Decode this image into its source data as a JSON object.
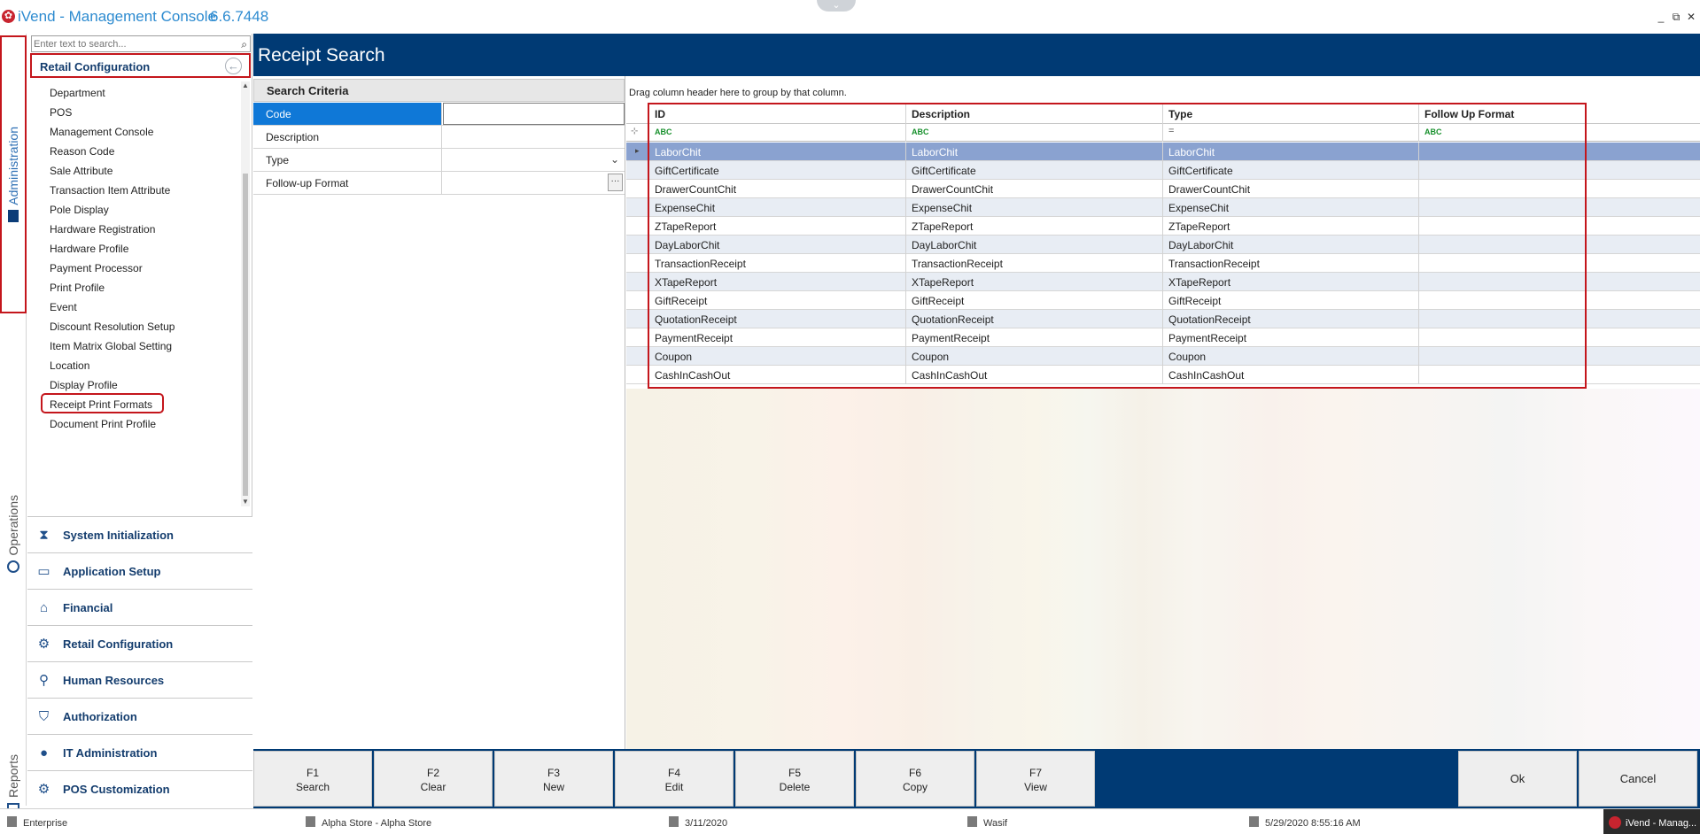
{
  "window": {
    "title": "iVend - Management Console",
    "version": "6.6.7448",
    "controls": {
      "minimize": "_",
      "restore": "⧉",
      "close": "✕"
    },
    "collapse_glyph": "⌄"
  },
  "vertical_tabs": {
    "administration": "Administration",
    "operations": "Operations",
    "reports": "Reports"
  },
  "sidebar": {
    "search_placeholder": "Enter text to search...",
    "section_title": "Retail Configuration",
    "items": [
      {
        "label": "Department"
      },
      {
        "label": "POS"
      },
      {
        "label": "Management Console"
      },
      {
        "label": "Reason Code"
      },
      {
        "label": "Sale Attribute"
      },
      {
        "label": "Transaction Item Attribute"
      },
      {
        "label": "Pole Display"
      },
      {
        "label": "Hardware Registration"
      },
      {
        "label": "Hardware Profile"
      },
      {
        "label": "Payment Processor"
      },
      {
        "label": "Print Profile"
      },
      {
        "label": "Event"
      },
      {
        "label": "Discount Resolution Setup"
      },
      {
        "label": "Item Matrix Global Setting"
      },
      {
        "label": "Location"
      },
      {
        "label": "Display Profile"
      },
      {
        "label": "Receipt Print Formats"
      },
      {
        "label": "Document Print Profile"
      }
    ],
    "categories": [
      {
        "label": "System Initialization",
        "icon": "hourglass-icon"
      },
      {
        "label": "Application Setup",
        "icon": "window-icon"
      },
      {
        "label": "Financial",
        "icon": "bank-icon"
      },
      {
        "label": "Retail Configuration",
        "icon": "gears-icon"
      },
      {
        "label": "Human Resources",
        "icon": "person-search-icon"
      },
      {
        "label": "Authorization",
        "icon": "shield-icon"
      },
      {
        "label": "IT Administration",
        "icon": "user-icon"
      },
      {
        "label": "POS Customization",
        "icon": "gear-icon"
      }
    ]
  },
  "page": {
    "title": "Receipt Search"
  },
  "criteria": {
    "title": "Search Criteria",
    "fields": [
      {
        "label": "Code",
        "value": ""
      },
      {
        "label": "Description",
        "value": ""
      },
      {
        "label": "Type",
        "value": ""
      },
      {
        "label": "Follow-up Format",
        "value": ""
      }
    ]
  },
  "grid": {
    "group_hint": "Drag column header here to group by that column.",
    "columns": [
      "ID",
      "Description",
      "Type",
      "Follow Up Format"
    ],
    "filter_glyphs": [
      "ABC",
      "ABC",
      "=",
      "ABC"
    ],
    "rows": [
      [
        "LaborChit",
        "LaborChit",
        "LaborChit",
        ""
      ],
      [
        "GiftCertificate",
        "GiftCertificate",
        "GiftCertificate",
        ""
      ],
      [
        "DrawerCountChit",
        "DrawerCountChit",
        "DrawerCountChit",
        ""
      ],
      [
        "ExpenseChit",
        "ExpenseChit",
        "ExpenseChit",
        ""
      ],
      [
        "ZTapeReport",
        "ZTapeReport",
        "ZTapeReport",
        ""
      ],
      [
        "DayLaborChit",
        "DayLaborChit",
        "DayLaborChit",
        ""
      ],
      [
        "TransactionReceipt",
        "TransactionReceipt",
        "TransactionReceipt",
        ""
      ],
      [
        "XTapeReport",
        "XTapeReport",
        "XTapeReport",
        ""
      ],
      [
        "GiftReceipt",
        "GiftReceipt",
        "GiftReceipt",
        ""
      ],
      [
        "QuotationReceipt",
        "QuotationReceipt",
        "QuotationReceipt",
        ""
      ],
      [
        "PaymentReceipt",
        "PaymentReceipt",
        "PaymentReceipt",
        ""
      ],
      [
        "Coupon",
        "Coupon",
        "Coupon",
        ""
      ],
      [
        "CashInCashOut",
        "CashInCashOut",
        "CashInCashOut",
        ""
      ]
    ]
  },
  "function_keys": [
    {
      "key": "F1",
      "label": "Search"
    },
    {
      "key": "F2",
      "label": "Clear"
    },
    {
      "key": "F3",
      "label": "New"
    },
    {
      "key": "F4",
      "label": "Edit"
    },
    {
      "key": "F5",
      "label": "Delete"
    },
    {
      "key": "F6",
      "label": "Copy"
    },
    {
      "key": "F7",
      "label": "View"
    }
  ],
  "actions": {
    "ok": "Ok",
    "cancel": "Cancel"
  },
  "status": {
    "edition": "Enterprise",
    "store": "Alpha Store - Alpha Store",
    "business_date": "3/11/2020",
    "user": "Wasif",
    "login_time": "5/29/2020 8:55:16 AM",
    "taskbar": "iVend - Manag..."
  },
  "colors": {
    "brand_blue": "#003a74",
    "highlight_red": "#c4161c",
    "selection_blue": "#0f78d7",
    "selected_row": "#8aa2d0"
  }
}
